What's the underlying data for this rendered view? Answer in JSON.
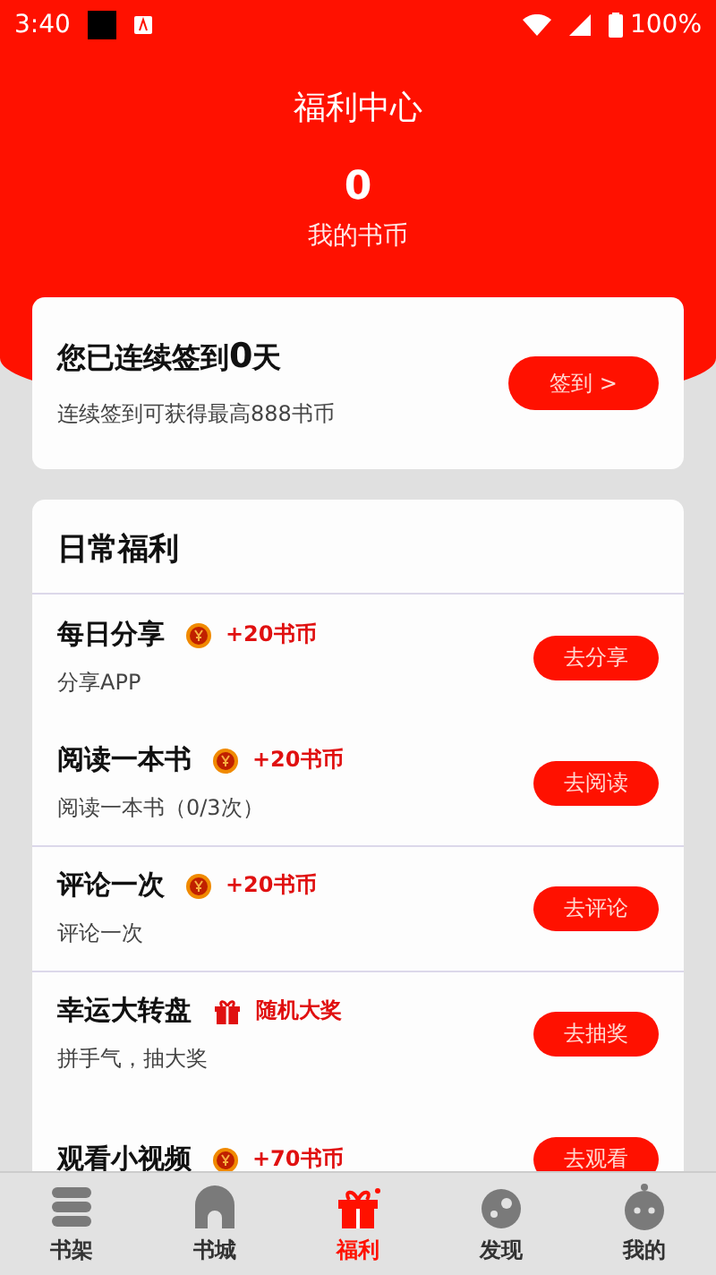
{
  "status_bar": {
    "time": "3:40",
    "battery": "100%"
  },
  "header": {
    "title": "福利中心",
    "coins": "0",
    "coins_label": "我的书币"
  },
  "sign_in": {
    "title_prefix": "您已连续签到",
    "days": "0",
    "title_suffix": "天",
    "subtitle": "连续签到可获得最高888书币",
    "button": "签到 >"
  },
  "daily": {
    "title": "日常福利",
    "tasks": [
      {
        "name": "每日分享",
        "kind": "coin",
        "reward": "+20书币",
        "subtitle": "分享APP",
        "button": "去分享",
        "divider": false
      },
      {
        "name": "阅读一本书",
        "kind": "coin",
        "reward": "+20书币",
        "subtitle": "阅读一本书（0/3次）",
        "button": "去阅读",
        "divider": false
      },
      {
        "name": "评论一次",
        "kind": "coin",
        "reward": "+20书币",
        "subtitle": "评论一次",
        "button": "去评论",
        "divider": true
      },
      {
        "name": "幸运大转盘",
        "kind": "gift",
        "reward": "随机大奖",
        "subtitle": "拼手气，抽大奖",
        "button": "去抽奖",
        "divider": true
      },
      {
        "name": "观看小视频",
        "kind": "coin",
        "reward": "+70书币",
        "button": "去观看",
        "divider": false
      }
    ]
  },
  "tab_bar": [
    {
      "label": "书架",
      "kind": "shelf",
      "selected": false
    },
    {
      "label": "书城",
      "kind": "arch",
      "selected": false
    },
    {
      "label": "福利",
      "kind": "gift",
      "selected": true
    },
    {
      "label": "发现",
      "kind": "planet",
      "selected": false
    },
    {
      "label": "我的",
      "kind": "face",
      "selected": false
    }
  ]
}
